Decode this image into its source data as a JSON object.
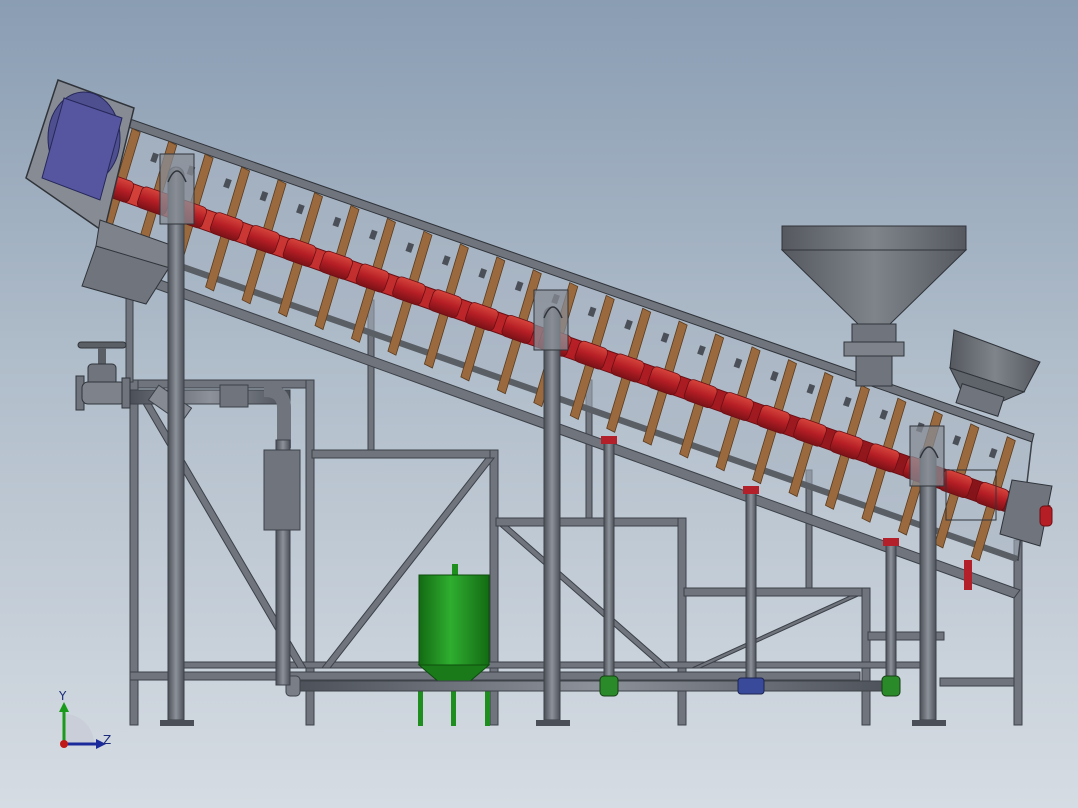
{
  "viewport": {
    "background_top": "#8a9db3",
    "background_bottom": "#d6dce3"
  },
  "triad": {
    "y_label": "Y",
    "z_label": "Z",
    "y_color": "#1a9a1a",
    "z_color": "#1b2a9a",
    "origin_color": "#c01818"
  },
  "colors": {
    "steel": "#6f747d",
    "steel_dark": "#4b5058",
    "steel_light": "#9ba0a8",
    "screw_shaft": "#b51e25",
    "flight": "#9a6a3e",
    "trough_glass": "#aab4c2",
    "motor": "#4e4f8f",
    "tank": "#1e8f1e",
    "valve_red": "#b3202a",
    "valve_green": "#2a8a2a",
    "valve_blue": "#3a4a9a"
  },
  "components": [
    "inclined-screw-conveyor",
    "drive-motor",
    "feed-hopper",
    "discharge-chute",
    "support-frame",
    "green-tank",
    "gate-valve",
    "vertical-pipes"
  ]
}
